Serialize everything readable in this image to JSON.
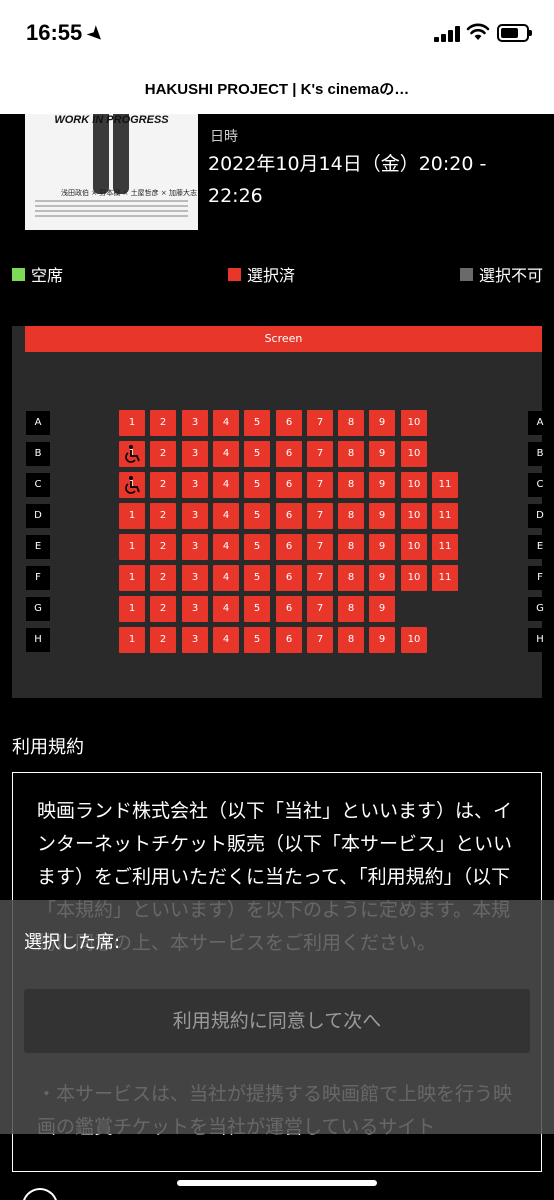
{
  "status_bar": {
    "time": "16:55"
  },
  "browser": {
    "page_title": "HAKUSHI PROJECT | K's cinemaの…"
  },
  "movie": {
    "poster_title": "WORK IN PROGRESS",
    "poster_credits": "浅田政伯 × 野本欄 × 土屋哲彦 × 加藤大志",
    "datetime_label": "日時",
    "datetime_value": "2022年10月14日（金）20:20 - 22:26"
  },
  "legend": {
    "available": {
      "label": "空席",
      "color": "#7ed957"
    },
    "selected": {
      "label": "選択済",
      "color": "#e8372a"
    },
    "unavailable": {
      "label": "選択不可",
      "color": "#6a6a6a"
    }
  },
  "seatmap": {
    "screen_label": "Screen",
    "rows": [
      {
        "label": "A",
        "seats": [
          "1",
          "2",
          "3",
          "4",
          "5",
          "6",
          "7",
          "8",
          "9",
          "10"
        ],
        "wheelchair": []
      },
      {
        "label": "B",
        "seats": [
          "1",
          "2",
          "3",
          "4",
          "5",
          "6",
          "7",
          "8",
          "9",
          "10"
        ],
        "wheelchair": [
          "1"
        ]
      },
      {
        "label": "C",
        "seats": [
          "1",
          "2",
          "3",
          "4",
          "5",
          "6",
          "7",
          "8",
          "9",
          "10",
          "11"
        ],
        "wheelchair": [
          "1"
        ]
      },
      {
        "label": "D",
        "seats": [
          "1",
          "2",
          "3",
          "4",
          "5",
          "6",
          "7",
          "8",
          "9",
          "10",
          "11"
        ],
        "wheelchair": []
      },
      {
        "label": "E",
        "seats": [
          "1",
          "2",
          "3",
          "4",
          "5",
          "6",
          "7",
          "8",
          "9",
          "10",
          "11"
        ],
        "wheelchair": []
      },
      {
        "label": "F",
        "seats": [
          "1",
          "2",
          "3",
          "4",
          "5",
          "6",
          "7",
          "8",
          "9",
          "10",
          "11"
        ],
        "wheelchair": []
      },
      {
        "label": "G",
        "seats": [
          "1",
          "2",
          "3",
          "4",
          "5",
          "6",
          "7",
          "8",
          "9"
        ],
        "wheelchair": []
      },
      {
        "label": "H",
        "seats": [
          "1",
          "2",
          "3",
          "4",
          "5",
          "6",
          "7",
          "8",
          "9",
          "10"
        ],
        "wheelchair": []
      }
    ]
  },
  "terms": {
    "heading": "利用規約",
    "body": "映画ランド株式会社（以下「当社」といいます）は、インターネットチケット販売（以下「本サービス」といいます）をご利用いただくに当たって、「利用規約」（以下「本規約」といいます）を以下のように定めます。本規約に同意の上、本サービスをご利用ください。",
    "bullet": "・本サービスは、当社が提携する映画館で上映を行う映画の鑑賞チケットを当社が運営しているサイト"
  },
  "selection_panel": {
    "selected_label": "選択した席:",
    "next_button": "利用規約に同意して次へ"
  }
}
